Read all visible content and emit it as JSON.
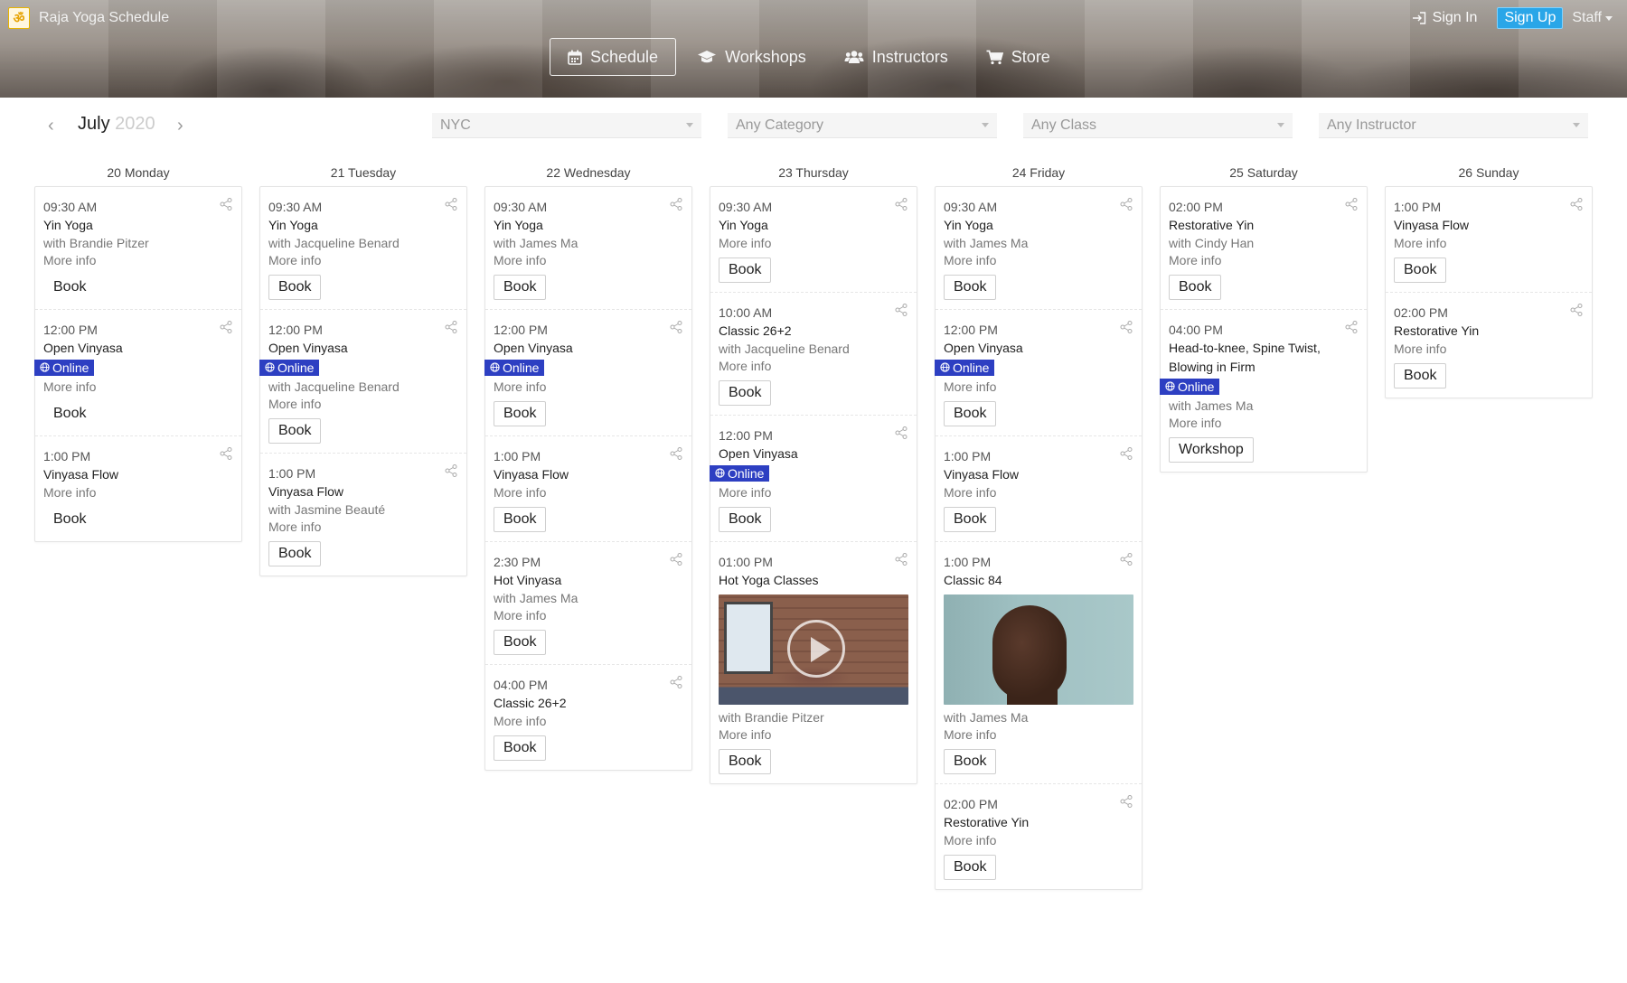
{
  "app": {
    "title": "Raja Yoga Schedule"
  },
  "header": {
    "nav": [
      {
        "label": "Schedule",
        "icon": "calendar-icon",
        "active": true
      },
      {
        "label": "Workshops",
        "icon": "graduation-cap-icon",
        "active": false
      },
      {
        "label": "Instructors",
        "icon": "users-icon",
        "active": false
      },
      {
        "label": "Store",
        "icon": "cart-icon",
        "active": false
      }
    ],
    "signin": "Sign In",
    "signup": "Sign Up",
    "staff": "Staff"
  },
  "toolbar": {
    "month": "July",
    "year": "2020",
    "filters": {
      "location": "NYC",
      "category": "Any Category",
      "class": "Any Class",
      "instructor": "Any Instructor"
    }
  },
  "colors": {
    "online_badge": "#2d3fc2",
    "signup": "#2aa6e8"
  },
  "days": [
    {
      "title": "20 Monday",
      "classes": [
        {
          "time": "09:30 AM",
          "name": "Yin Yoga",
          "instructor": "with Brandie Pitzer",
          "more": "More info",
          "button": "Book"
        },
        {
          "time": "12:00 PM",
          "name": "Open Vinyasa",
          "online": "Online",
          "more": "More info",
          "button": "Book"
        },
        {
          "time": "1:00 PM",
          "name": "Vinyasa Flow",
          "more": "More info",
          "button": "Book"
        }
      ]
    },
    {
      "title": "21 Tuesday",
      "classes": [
        {
          "time": "09:30 AM",
          "name": "Yin Yoga",
          "instructor": "with Jacqueline Benard",
          "more": "More info",
          "button": "Book"
        },
        {
          "time": "12:00 PM",
          "name": "Open Vinyasa",
          "online": "Online",
          "instructor": "with Jacqueline Benard",
          "more": "More info",
          "button": "Book"
        },
        {
          "time": "1:00 PM",
          "name": "Vinyasa Flow",
          "instructor": "with Jasmine Beauté",
          "more": "More info",
          "button": "Book"
        }
      ]
    },
    {
      "title": "22 Wednesday",
      "classes": [
        {
          "time": "09:30 AM",
          "name": "Yin Yoga",
          "instructor": "with James Ma",
          "more": "More info",
          "button": "Book"
        },
        {
          "time": "12:00 PM",
          "name": "Open Vinyasa",
          "online": "Online",
          "more": "More info",
          "button": "Book"
        },
        {
          "time": "1:00 PM",
          "name": "Vinyasa Flow",
          "more": "More info",
          "button": "Book"
        },
        {
          "time": "2:30 PM",
          "name": "Hot Vinyasa",
          "instructor": "with James Ma",
          "more": "More info",
          "button": "Book"
        },
        {
          "time": "04:00 PM",
          "name": "Classic 26+2",
          "more": "More info",
          "button": "Book"
        }
      ]
    },
    {
      "title": "23 Thursday",
      "classes": [
        {
          "time": "09:30 AM",
          "name": "Yin Yoga",
          "more": "More info",
          "button": "Book"
        },
        {
          "time": "10:00 AM",
          "name": "Classic 26+2",
          "instructor": "with Jacqueline Benard",
          "more": "More info",
          "button": "Book"
        },
        {
          "time": "12:00 PM",
          "name": "Open Vinyasa",
          "online": "Online",
          "more": "More info",
          "button": "Book"
        },
        {
          "time": "01:00 PM",
          "name": "Hot Yoga Classes",
          "media": "video",
          "instructor": "with Brandie Pitzer",
          "more": "More info",
          "button": "Book"
        }
      ]
    },
    {
      "title": "24 Friday",
      "classes": [
        {
          "time": "09:30 AM",
          "name": "Yin Yoga",
          "instructor": "with James Ma",
          "more": "More info",
          "button": "Book"
        },
        {
          "time": "12:00 PM",
          "name": "Open Vinyasa",
          "online": "Online",
          "more": "More info",
          "button": "Book"
        },
        {
          "time": "1:00 PM",
          "name": "Vinyasa Flow",
          "more": "More info",
          "button": "Book"
        },
        {
          "time": "1:00 PM",
          "name": "Classic 84",
          "media": "photo",
          "instructor": "with James Ma",
          "more": "More info",
          "button": "Book"
        },
        {
          "time": "02:00 PM",
          "name": "Restorative Yin",
          "more": "More info",
          "button": "Book"
        }
      ]
    },
    {
      "title": "25 Saturday",
      "classes": [
        {
          "time": "02:00 PM",
          "name": "Restorative Yin",
          "instructor": "with Cindy Han",
          "more": "More info",
          "button": "Book"
        },
        {
          "time": "04:00 PM",
          "name": "Head-to-knee, Spine Twist, Blowing in Firm",
          "online": "Online",
          "instructor": "with James Ma",
          "more": "More info",
          "button": "Workshop"
        }
      ]
    },
    {
      "title": "26 Sunday",
      "classes": [
        {
          "time": "1:00 PM",
          "name": "Vinyasa Flow",
          "more": "More info",
          "button": "Book"
        },
        {
          "time": "02:00 PM",
          "name": "Restorative Yin",
          "more": "More info",
          "button": "Book"
        }
      ]
    }
  ]
}
